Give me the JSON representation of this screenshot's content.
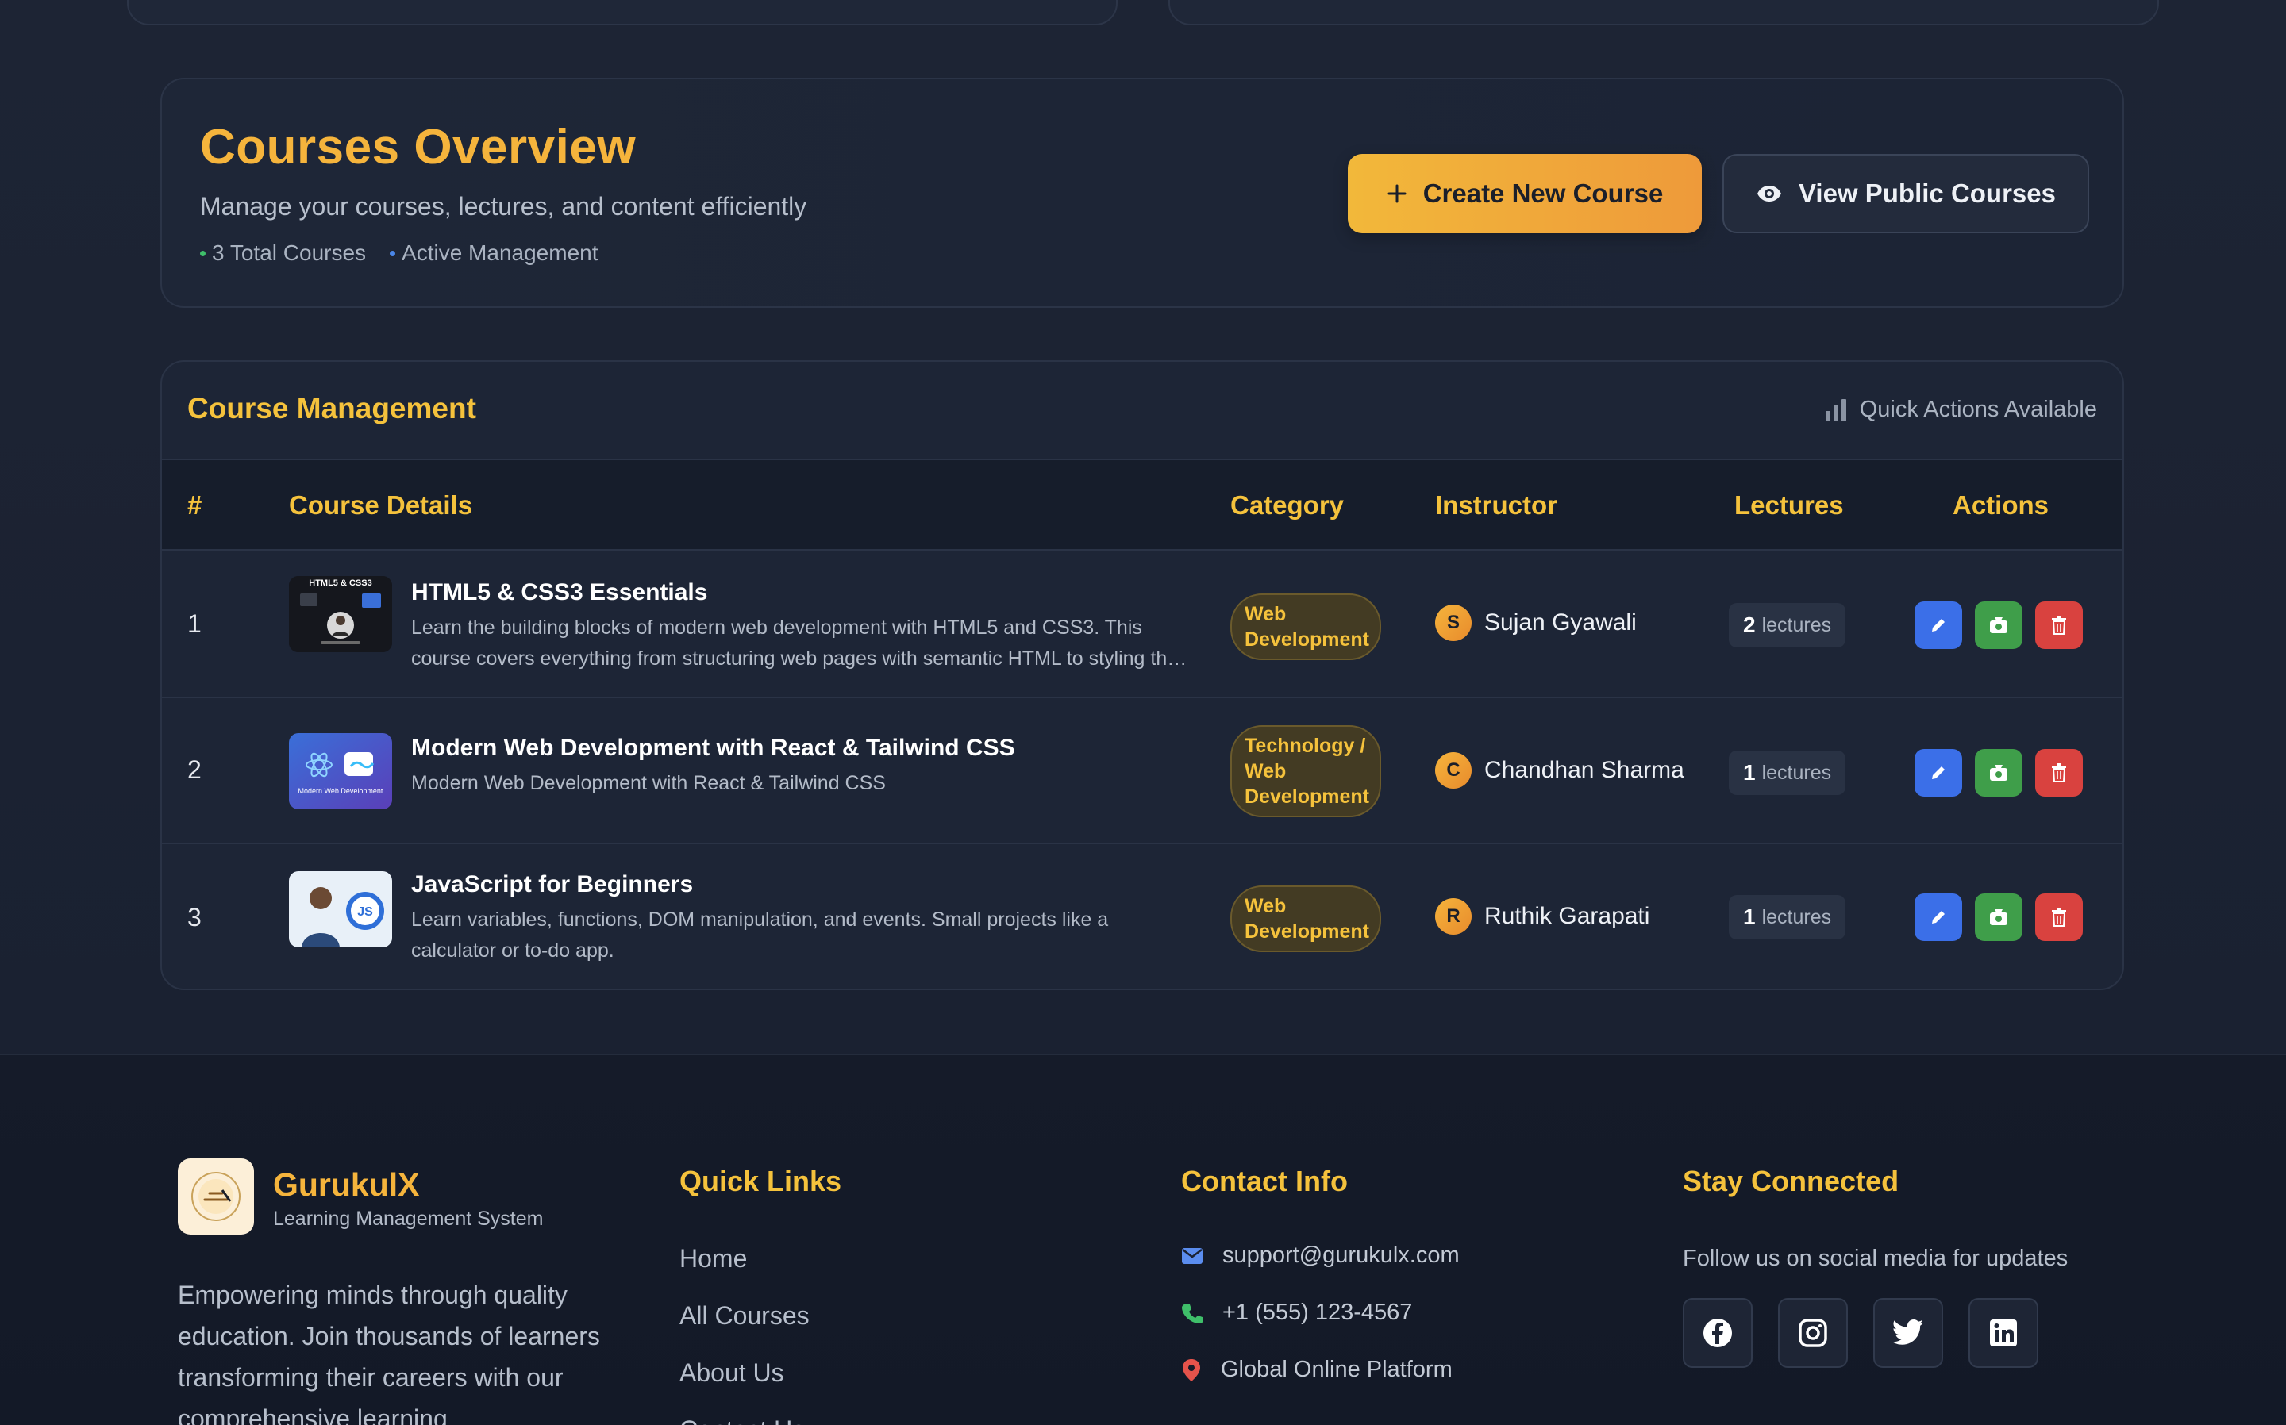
{
  "overview": {
    "title": "Courses Overview",
    "subtitle": "Manage your courses, lectures, and content efficiently",
    "stat_total": "3 Total Courses",
    "stat_active": "Active Management",
    "create_label": "Create New Course",
    "view_label": "View Public Courses"
  },
  "management": {
    "title": "Course Management",
    "quick_actions": "Quick Actions Available",
    "columns": {
      "index": "#",
      "details": "Course Details",
      "category": "Category",
      "instructor": "Instructor",
      "lectures": "Lectures",
      "actions": "Actions"
    },
    "rows": [
      {
        "index": "1",
        "title": "HTML5 & CSS3 Essentials",
        "description": "Learn the building blocks of modern web development with HTML5 and CSS3. This course covers everything from structuring web pages with semantic HTML to styling them with CSS.",
        "category": "Web Development",
        "instructor_initial": "S",
        "instructor": "Sujan Gyawali",
        "lecture_count": "2",
        "lecture_unit": "lectures",
        "thumb_text": "HTML5 & CSS3"
      },
      {
        "index": "2",
        "title": "Modern Web Development with React & Tailwind CSS",
        "description": "Modern Web Development with React & Tailwind CSS",
        "category": "Technology / Web Development",
        "instructor_initial": "C",
        "instructor": "Chandhan Sharma",
        "lecture_count": "1",
        "lecture_unit": "lectures",
        "thumb_text": "Modern Web Development"
      },
      {
        "index": "3",
        "title": "JavaScript for Beginners",
        "description": "Learn variables, functions, DOM manipulation, and events. Small projects like a calculator or to-do app.",
        "category": "Web Development",
        "instructor_initial": "R",
        "instructor": "Ruthik Garapati",
        "lecture_count": "1",
        "lecture_unit": "lectures",
        "thumb_text": "JS"
      }
    ]
  },
  "footer": {
    "brand": "GurukulX",
    "brand_sub": "Learning Management System",
    "about": "Empowering minds through quality education. Join thousands of learners transforming their careers with our comprehensive learning",
    "quick_links_title": "Quick Links",
    "links": [
      "Home",
      "All Courses",
      "About Us",
      "Contact Us"
    ],
    "contact_title": "Contact Info",
    "email": "support@gurukulx.com",
    "phone": "+1 (555) 123-4567",
    "location": "Global Online Platform",
    "stay_title": "Stay Connected",
    "follow_text": "Follow us on social media for updates",
    "socials": [
      "facebook-icon",
      "instagram-icon",
      "twitter-icon",
      "linkedin-icon"
    ]
  },
  "colors": {
    "accent": "#f5b43c",
    "heading": "#f5c23c",
    "edit": "#3b6fe8",
    "video": "#3f9e4a",
    "delete": "#d9423f"
  }
}
